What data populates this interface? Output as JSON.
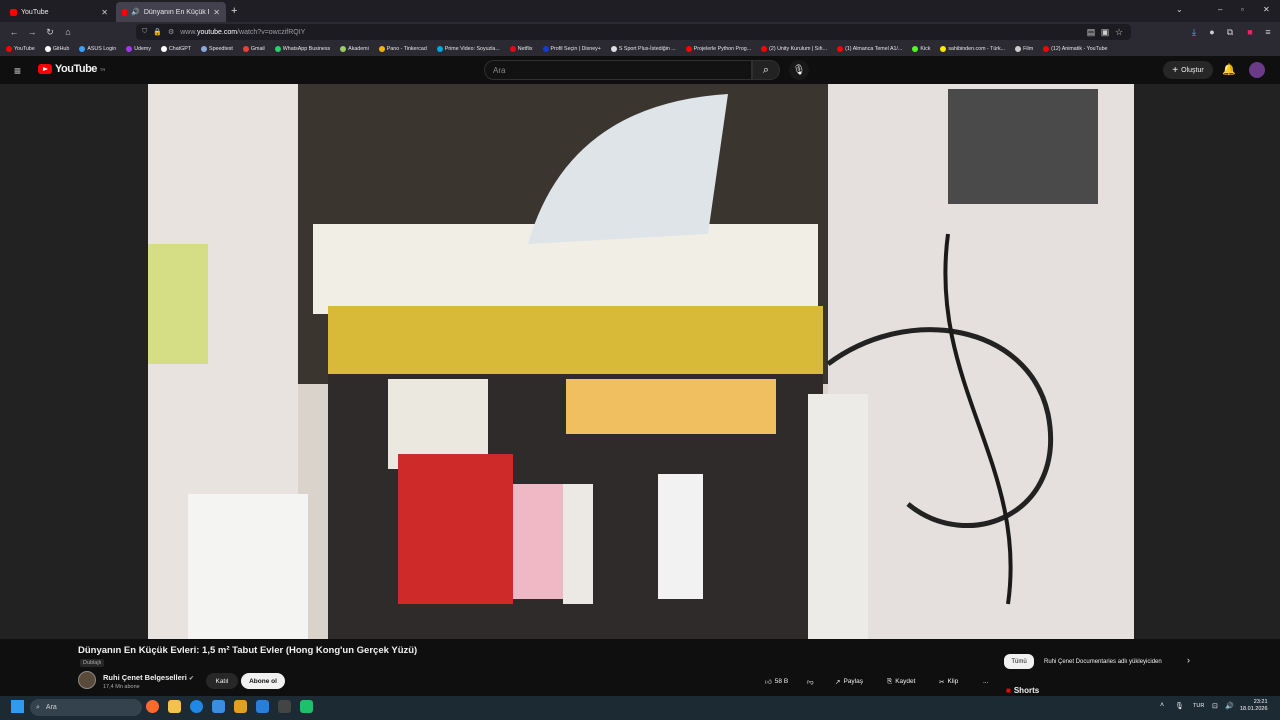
{
  "browser": {
    "tabs": [
      {
        "label": "YouTube",
        "active": false
      },
      {
        "label": "Dünyanın En Küçük Evleri: 1",
        "active": true
      }
    ],
    "url_prefix": "www.",
    "url_host": "youtube.com",
    "url_path": "/watch?v=owczifRQIY",
    "bookmarks": [
      {
        "label": "YouTube",
        "color": "#ff0000"
      },
      {
        "label": "GitHub",
        "color": "#ffffff"
      },
      {
        "label": "ASUS Login",
        "color": "#3aa0ff"
      },
      {
        "label": "Udemy",
        "color": "#a435f0"
      },
      {
        "label": "ChatGPT",
        "color": "#ffffff"
      },
      {
        "label": "Speedtest",
        "color": "#8ad"
      },
      {
        "label": "Gmail",
        "color": "#ea4335"
      },
      {
        "label": "WhatsApp Business",
        "color": "#25d366"
      },
      {
        "label": "Akademi",
        "color": "#9ccc65"
      },
      {
        "label": "Pano - Tinkercad",
        "color": "#f4b400"
      },
      {
        "label": "Prime Video: Soyuzla...",
        "color": "#00a8e1"
      },
      {
        "label": "Netflix",
        "color": "#e50914"
      },
      {
        "label": "Profil Seçin | Disney+",
        "color": "#113ccf"
      },
      {
        "label": "S Sport Plus-İstediğin ...",
        "color": "#dddddd"
      },
      {
        "label": "Projelerle Python Prog...",
        "color": "#ff0000"
      },
      {
        "label": "(2) Unity Kurulum | Sıfı...",
        "color": "#ff0000"
      },
      {
        "label": "(1) Almanca Temel A1/...",
        "color": "#ff0000"
      },
      {
        "label": "Kick",
        "color": "#53fc18"
      },
      {
        "label": "sahibinden.com - Türk...",
        "color": "#ffe800"
      },
      {
        "label": "Film",
        "color": "#cccccc"
      },
      {
        "label": "(12) Animatik - YouTube",
        "color": "#ff0000"
      }
    ]
  },
  "youtube": {
    "logo_text": "YouTube",
    "logo_sup": "TR",
    "search_placeholder": "Ara",
    "create_label": "Oluştur",
    "video": {
      "title": "Dünyanın En Küçük Evleri: 1,5 m² Tabut Evler (Hong Kong'un Gerçek Yüzü)",
      "dubbed": "Dublajlı",
      "channel": "Ruhi Çenet Belgeselleri",
      "subscribers": "17,4 Mn abone",
      "join": "Katıl",
      "subscribe": "Abone ol",
      "likes": "58 B",
      "share": "Paylaş",
      "save": "Kaydet",
      "clip": "Klip",
      "more": "..."
    },
    "chips": {
      "all": "Tümü",
      "second": "Ruhi Çenet Documentaries adlı yükleyiciden"
    },
    "shorts_label": "Shorts"
  },
  "taskbar": {
    "search_placeholder": "Ara",
    "lang": "TUR",
    "time": "23:21",
    "date": "18.01.2026"
  }
}
